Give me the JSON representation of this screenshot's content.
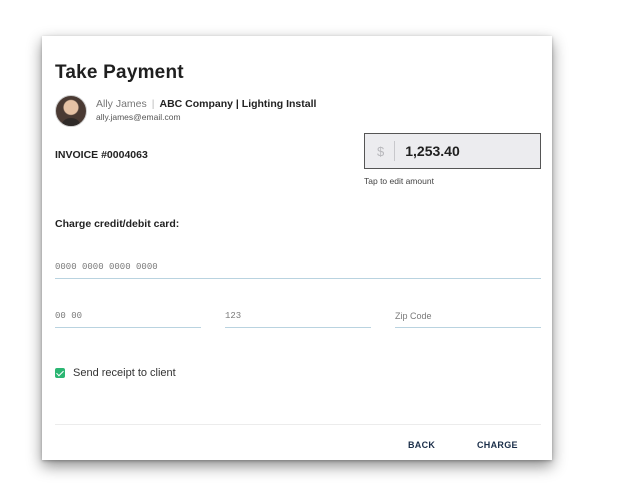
{
  "dialog": {
    "title": "Take Payment"
  },
  "client": {
    "name": "Ally James",
    "company": "ABC Company | Lighting Install",
    "email": "ally.james@email.com"
  },
  "invoice": {
    "label": "INVOICE #0004063"
  },
  "amount": {
    "currency_symbol": "$",
    "value": "1,253.40",
    "hint": "Tap to edit amount"
  },
  "card": {
    "section_label": "Charge credit/debit card:",
    "number_placeholder": "0000 0000 0000 0000",
    "expiry_placeholder": "00 00",
    "cvc_placeholder": "123",
    "zip_placeholder": "Zip Code"
  },
  "receipt": {
    "label": "Send receipt to client",
    "checked": true,
    "check_color": "#2bb673"
  },
  "actions": {
    "back_label": "BACK",
    "charge_label": "CHARGE"
  }
}
